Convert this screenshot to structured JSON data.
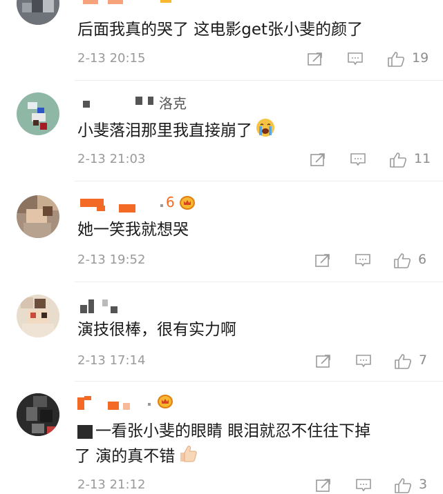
{
  "comments": [
    {
      "text": "后面我真的哭了 这电影get张小斐的颜了",
      "time": "2-13 20:15",
      "likes": "19"
    },
    {
      "username_visible": "洛克",
      "text": "小斐落泪那里我直接崩了",
      "emoji_icon": "crying-face-icon",
      "time": "2-13 21:03",
      "likes": "11"
    },
    {
      "username_visible": "6",
      "badge_icon": "crown-badge-icon",
      "text": "她一笑我就想哭",
      "time": "2-13 19:52",
      "likes": "6"
    },
    {
      "text": "演技很棒，很有实力啊",
      "time": "2-13 17:14",
      "likes": "7"
    },
    {
      "badge_icon": "crown-badge-icon",
      "text_line1": "一看张小斐的眼睛 眼泪就忍不住往下掉",
      "text_line2": "了 演的真不错",
      "emoji_icon": "thumbs-up-emoji-icon",
      "time": "2-13 21:12",
      "likes": "3"
    }
  ],
  "icons": {
    "share": "share-icon",
    "comment": "comment-icon",
    "like": "thumbs-up-icon"
  },
  "colors": {
    "meta_gray": "#9a9a9a",
    "username_orange": "#f26a25",
    "crown_gold": "#f7b731"
  }
}
